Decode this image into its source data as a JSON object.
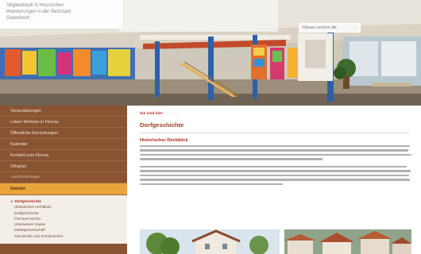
{
  "header": {
    "search_placeholder": "Hessen suchen die"
  },
  "sidebar": {
    "items": [
      {
        "label": "Veranstaltungen"
      },
      {
        "label": "Leben Wohnen in Florrau"
      },
      {
        "label": "Öffentliche Einrichtungen"
      },
      {
        "label": "Kalender"
      },
      {
        "label": "Kontakt zum Florrau"
      },
      {
        "label": "Ortsplan"
      },
      {
        "label": "Ausschreibungen"
      },
      {
        "label": "Dateien"
      }
    ],
    "sub_items": [
      {
        "label": "Dorfgeschichte"
      },
      {
        "label": "Historisches Verhältnis"
      },
      {
        "label": "Dorfgeschichte"
      },
      {
        "label": "Florrauer Kirche"
      },
      {
        "label": "Unterwieser Gasse"
      },
      {
        "label": "Marktgemeinschaft"
      },
      {
        "label": "Geschichte und Schuhmacher"
      }
    ]
  },
  "main": {
    "breadcrumb_prefix": "Sie sind hier:",
    "page_title": "Dorfgeschichte",
    "section_heading": "Historischer Rückblick"
  },
  "colors": {
    "sidebar_bg": "#8a5332",
    "active_item": "#e9a43a",
    "accent_red": "#b3261e"
  }
}
